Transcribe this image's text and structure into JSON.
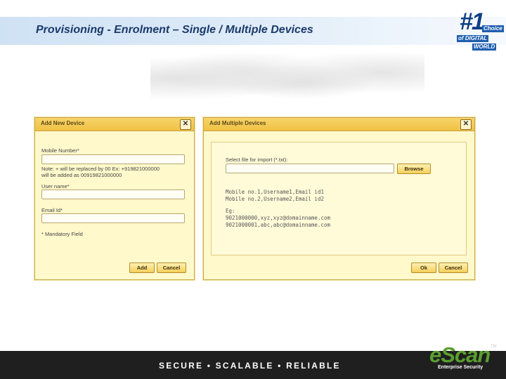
{
  "slide": {
    "title": "Provisioning - Enrolment – Single / Multiple Devices"
  },
  "badge": {
    "number": "#1",
    "line1": "Choice",
    "line2": "of DIGITAL",
    "line3": "WORLD"
  },
  "single_dialog": {
    "title": "Add New Device",
    "mobile_label": "Mobile Number*",
    "note_line1": "Note: + will be replaced by 00 Ex: +919821000000",
    "note_line2": "will be added as 00919821000000",
    "username_label": "User name*",
    "email_label": "Email Id*",
    "mandatory_note": "* Mandatory Field",
    "add_label": "Add",
    "cancel_label": "Cancel",
    "mobile_value": "",
    "username_value": "",
    "email_value": ""
  },
  "multi_dialog": {
    "title": "Add Multiple Devices",
    "file_label": "Select file for import (*.txt):",
    "file_value": "",
    "browse_label": "Browse",
    "format_lines": [
      "Mobile no.1,Username1,Email id1",
      "Mobile no.2,Username2,Email id2"
    ],
    "example_label": "Eg:",
    "example_lines": [
      "9021000000,xyz,xyz@domainname.com",
      "9021000001,abc,abc@domainname.com"
    ],
    "ok_label": "Ok",
    "cancel_label": "Cancel"
  },
  "footer": {
    "tagline": "SECURE • SCALABLE • RELIABLE",
    "logo": "eScan",
    "logo_sub": "Enterprise Security",
    "tm": "TM"
  },
  "colors": {
    "title_text": "#1b3a6b",
    "dialog_bg": "#fff9cc",
    "titlebar": "#f0c244",
    "logo_green": "#5a9e2f",
    "footer_bg": "#1f1f1f"
  }
}
